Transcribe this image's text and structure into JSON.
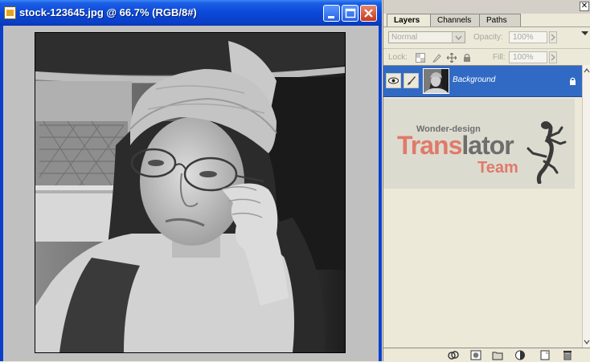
{
  "document": {
    "title": "stock-123645.jpg @ 66.7% (RGB/8#)",
    "icons": [
      "photoshop-doc-icon",
      "minimize-icon",
      "maximize-icon",
      "close-icon"
    ]
  },
  "layers_panel": {
    "tabs": [
      {
        "label": "Layers",
        "active": true
      },
      {
        "label": "Channels",
        "active": false
      },
      {
        "label": "Paths",
        "active": false
      }
    ],
    "blend_mode": "Normal",
    "opacity_label": "Opacity:",
    "opacity_value": "100%",
    "lock_label": "Lock:",
    "fill_label": "Fill:",
    "fill_value": "100%",
    "layers": [
      {
        "name": "Background",
        "visible": true,
        "locked": true,
        "selected": true
      }
    ],
    "watermark": {
      "line1": "Wonder-design",
      "line2_a": "Trans",
      "line2_b": "lator",
      "line3": "Team"
    },
    "bottom_icons": [
      "link-layers-icon",
      "add-mask-icon",
      "new-group-icon",
      "adjustment-layer-icon",
      "new-layer-icon",
      "delete-layer-icon"
    ]
  },
  "colors": {
    "title_bar": "#0a48d8",
    "selected_layer": "#316ac5",
    "watermark_red": "#e07a6a",
    "watermark_grey": "#6e6e6e"
  }
}
